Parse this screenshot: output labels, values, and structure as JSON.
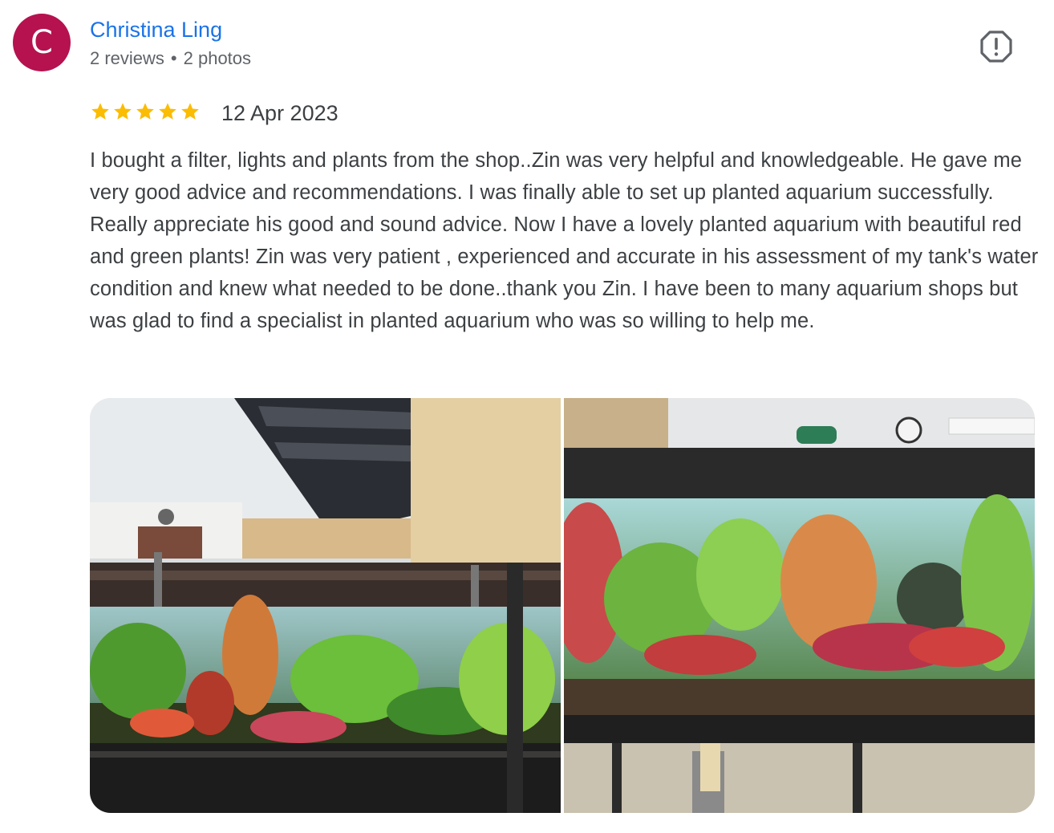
{
  "reviewer": {
    "avatar_letter": "C",
    "avatar_color": "#b5124f",
    "name": "Christina Ling",
    "reviews_count": "2 reviews",
    "separator": "•",
    "photos_count": "2 photos"
  },
  "rating": {
    "stars": 5,
    "star_color": "#fbbc04"
  },
  "date": "12 Apr 2023",
  "review_text": "I bought a filter, lights and plants from the shop..Zin was very helpful and knowledgeable. He gave me very good advice and recommendations. I was finally able to set up planted aquarium successfully. Really appreciate his good and sound advice. Now I have a lovely planted aquarium with beautiful red and green plants! Zin was very patient , experienced and accurate in his assessment of my tank's water condition and knew what needed to be done..thank you Zin. I have been to many aquarium shops but was glad to find a specialist in planted aquarium who was so willing to help me.",
  "icons": {
    "report": "report-flag-icon",
    "star": "star-icon"
  }
}
